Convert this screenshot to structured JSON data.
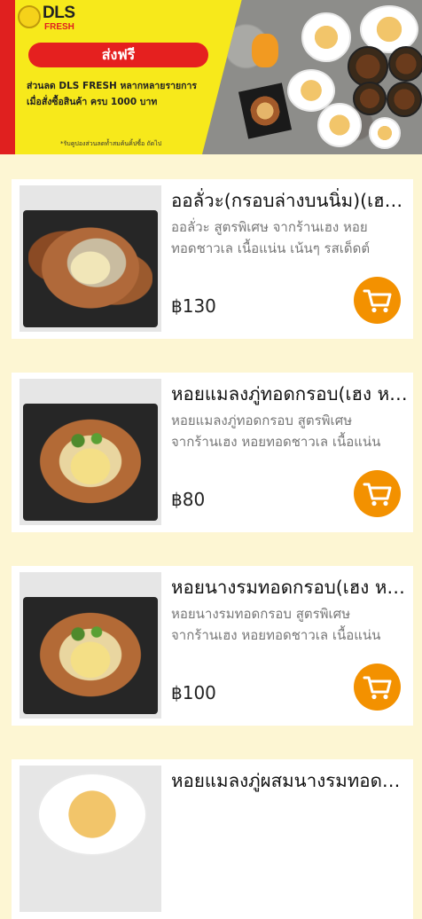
{
  "banner": {
    "logo_line1": "DLS",
    "logo_line2": "FRESH",
    "free_shipping": "ส่งฟรี",
    "promo_line1": "ส่วนลด DLS FRESH หลากหลายรายการ",
    "promo_line2": "เมื่อสั่งซื้อสินค้า ครบ 1000 บาท",
    "fine_print": "*รับคูปองส่วนลดท้ำสมค้นคิ้ปซื้อ ถัดไป"
  },
  "products": [
    {
      "name": "ออลั่วะ(กรอบล่างบนนิ่ม)(เฮง หอยทอดชาวเล)",
      "desc_line1": "ออลั่วะ สูตรพิเศษ จากร้านเฮง หอย",
      "desc_line2": "ทอดชาวเล เนื้อแน่น เน้นๆ รสเด็ดต์",
      "price": "฿130",
      "cart_icon": "shopping-cart-icon"
    },
    {
      "name": "หอยแมลงภู่ทอดกรอบ(เฮง หอยทอดชาวเล)",
      "desc_line1": "หอยแมลงภู่ทอดกรอบ สูตรพิเศษ",
      "desc_line2": "จากร้านเฮง หอยทอดชาวเล เนื้อแน่น",
      "price": "฿80",
      "cart_icon": "shopping-cart-icon"
    },
    {
      "name": "หอยนางรมทอดกรอบ(เฮง หอยทอดชาวเล)",
      "desc_line1": "หอยนางรมทอดกรอบ สูตรพิเศษ",
      "desc_line2": "จากร้านเฮง หอยทอดชาวเล เนื้อแน่น",
      "price": "฿100",
      "cart_icon": "shopping-cart-icon"
    },
    {
      "name": "หอยแมลงภู่ผสมนางรมทอดกรอบ",
      "desc_line1": "",
      "desc_line2": "",
      "price": "",
      "cart_icon": "shopping-cart-icon"
    }
  ],
  "colors": {
    "background": "#fdf6d3",
    "banner_yellow": "#f7e91b",
    "accent_red": "#e5201f",
    "cart_orange": "#f39100"
  }
}
